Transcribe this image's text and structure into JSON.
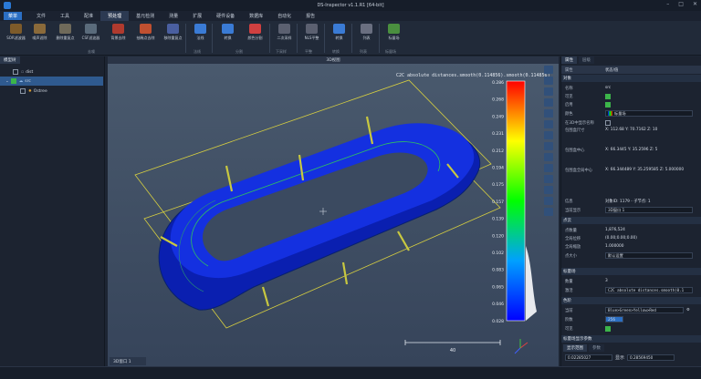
{
  "title": "DS-Inspector v1.1.R1 [64-bit]",
  "menu": {
    "home": "菜单",
    "items": [
      "文件",
      "工具",
      "配准",
      "预处理",
      "基元检测",
      "测量",
      "扩展",
      "硬件设备",
      "数据库",
      "自动化",
      "报告"
    ],
    "active_index": 3
  },
  "ribbon": {
    "buttons": [
      "SOR滤波器",
      "噪声滤除",
      "删除重复点",
      "CSF滤波器",
      "背景去除",
      "抽稀点去除",
      "移除重复点",
      "法线",
      "转换",
      "颜色分割",
      "二次采样",
      "NLS平整",
      "转换",
      "列表",
      "标量场"
    ],
    "colors": [
      "#7d5b2a",
      "#8a6a3a",
      "#6f6a5a",
      "#5a6b7b",
      "#b03a2e",
      "#c05030",
      "#4a5fa0",
      "#3a7bd5",
      "#3a7bd5",
      "#d04040",
      "#5b6070",
      "#5b6070",
      "#3a7bd5",
      "#6a6f80",
      "#4a8f3f"
    ],
    "groups": [
      "去噪",
      "法线",
      "分割",
      "下采样",
      "平整",
      "转换",
      "列表",
      "标量场"
    ]
  },
  "left_panel": {
    "tab": "模型树",
    "items": [
      {
        "label": "dist",
        "checked": false
      },
      {
        "label": "src",
        "checked": true
      },
      {
        "label": "Ostree",
        "checked": false
      }
    ]
  },
  "viewport": {
    "title": "3D视图",
    "scalar_title": "C2C absolute distances.smooth(0.114856).smooth(0.114856)",
    "scale_ticks": [
      "0.286",
      "0.268",
      "0.249",
      "0.231",
      "0.212",
      "0.194",
      "0.175",
      "0.157",
      "0.139",
      "0.120",
      "0.102",
      "0.083",
      "0.065",
      "0.046",
      "0.028"
    ],
    "scale_bar": "40",
    "tab": "3D窗口 1"
  },
  "right_panel": {
    "tabs": [
      "属性",
      "层级"
    ],
    "header_k": "属性",
    "header_v": "状态/值",
    "sections": {
      "object": "对象",
      "cloud": "点云",
      "scalar": "标量场",
      "color": "色阶",
      "display": "标量场显示参数"
    },
    "rows": [
      {
        "k": "名称",
        "v": "src"
      },
      {
        "k": "可见",
        "v": ""
      },
      {
        "k": "启用",
        "v": ""
      },
      {
        "k": "颜色",
        "v": "标量场"
      },
      {
        "k": "在3D中显示名称",
        "v": ""
      },
      {
        "k": "包围盒尺寸",
        "v": "X: 112.68  Y: 70.7162  Z: 10"
      },
      {
        "k": "包围盒中心",
        "v": "X: 66.3445  Y: 35.2596  Z: 5"
      },
      {
        "k": "包围盒全局中心",
        "v": "X: 66.344489  Y: 35.259585  Z: 5.000000"
      },
      {
        "k": "信息",
        "v": "对象ID: 1179 - 子节点: 1"
      },
      {
        "k": "当前显示",
        "v": "3D窗口 1"
      },
      {
        "k": "点数量",
        "v": "1,876,524"
      },
      {
        "k": "全局位移",
        "v": "(0.00;0.00;0.00)"
      },
      {
        "k": "全局缩放",
        "v": "1.000000"
      },
      {
        "k": "点大小",
        "v": "默认设置"
      },
      {
        "k": "数量",
        "v": "3"
      },
      {
        "k": "激活",
        "v": "C2C absolute distances.smooth(0.1"
      },
      {
        "k": "当前",
        "v": "Blue>Green>Yellow>Red"
      },
      {
        "k": "阶数",
        "v": "256"
      },
      {
        "k": "可见",
        "v": ""
      }
    ],
    "display_tabs": [
      "显示范围",
      "参数"
    ],
    "range_low": "0.02285027",
    "range_label": "显示",
    "range_high": "0.28569450"
  }
}
